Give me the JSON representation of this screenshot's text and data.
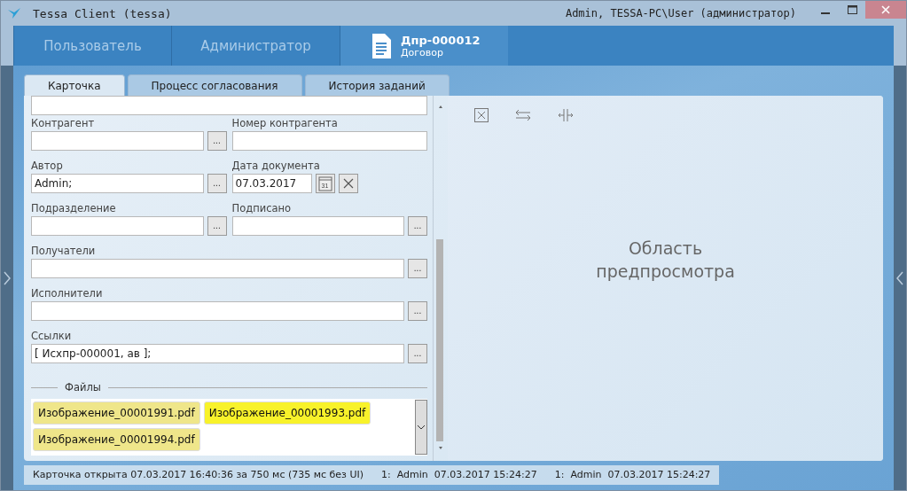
{
  "window": {
    "title": "Tessa Client (tessa)",
    "user": "Admin, TESSA-PC\\User (администратор)"
  },
  "nav": [
    {
      "kind": "plain",
      "label": "Пользователь",
      "selected": false
    },
    {
      "kind": "plain",
      "label": "Администратор",
      "selected": false
    },
    {
      "kind": "document",
      "label": "Дпр-000012",
      "sublabel": "Договор",
      "selected": true
    }
  ],
  "card_tabs": [
    {
      "label": "Карточка",
      "selected": true
    },
    {
      "label": "Процесс согласования",
      "selected": false
    },
    {
      "label": "История заданий",
      "selected": false
    }
  ],
  "form": {
    "rows": [
      [
        {
          "kind": "text"
        }
      ],
      [
        {
          "kind": "lookup",
          "label": "Контрагент",
          "button": "..."
        },
        {
          "kind": "text",
          "label": "Номер контрагента"
        }
      ],
      [
        {
          "kind": "lookup",
          "label": "Автор",
          "value": "Admin;",
          "button": "..."
        },
        {
          "kind": "date",
          "label": "Дата документа",
          "value": "07.03.2017",
          "calendar_day": "31"
        }
      ],
      [
        {
          "kind": "lookup",
          "label": "Подразделение",
          "button": "..."
        },
        {
          "kind": "lookup",
          "label": "Подписано",
          "button": "..."
        }
      ],
      [
        {
          "kind": "lookup",
          "label": "Получатели",
          "button": "..."
        }
      ],
      [
        {
          "kind": "lookup",
          "label": "Исполнители",
          "button": "..."
        }
      ],
      [
        {
          "kind": "lookup",
          "label": "Ссылки",
          "value": "[ Исхпр-000001, ав ];",
          "button": "..."
        }
      ]
    ],
    "files_title": "Файлы",
    "files": [
      {
        "name": "Изображение_00001991.pdf",
        "selected": false
      },
      {
        "name": "Изображение_00001993.pdf",
        "selected": true
      },
      {
        "name": "Изображение_00001994.pdf",
        "selected": false
      }
    ]
  },
  "preview": {
    "text": "Область предпросмотра"
  },
  "status_bar": [
    "Карточка открыта 07.03.2017 16:40:36 за 750 мс (735 мс без UI)",
    "1:  Admin  07.03.2017 15:24:27",
    "1:  Admin  07.03.2017 15:24:27"
  ]
}
